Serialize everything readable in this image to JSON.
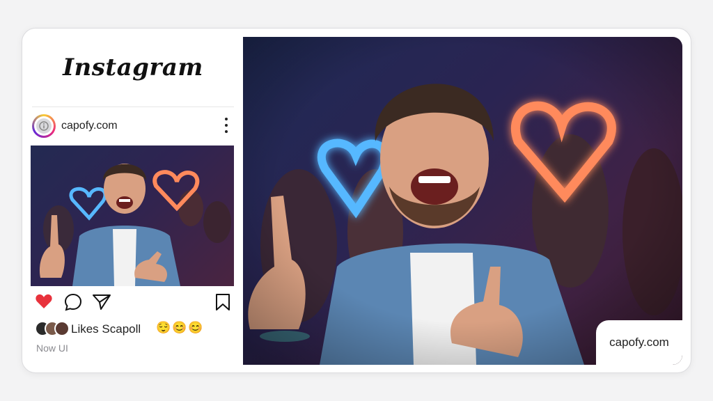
{
  "brand": {
    "logo_text": "Instagram"
  },
  "post": {
    "username": "capofy.com",
    "likes_text": "Likes Scapoll",
    "emojis": "😌😊😊",
    "timestamp": "Now UI",
    "liked": true
  },
  "watermark": {
    "text": "capofy.com"
  },
  "colors": {
    "heart_red": "#e8323c",
    "neon_blue": "#57b8ff",
    "neon_orange": "#ff8a5c",
    "shirt_denim": "#5b86b3"
  },
  "icons": [
    "info-icon",
    "more-vert-icon",
    "heart-icon",
    "comment-icon",
    "share-icon",
    "bookmark-icon"
  ]
}
